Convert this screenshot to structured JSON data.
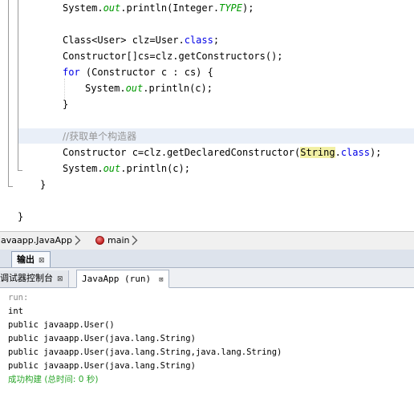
{
  "editor": {
    "line1": {
      "a": "System.",
      "b": "out",
      "c": ".println(Integer.",
      "d": "TYPE",
      "e": ");"
    },
    "line2": {
      "a": "Class<User> clz=User.",
      "b": "class",
      "c": ";"
    },
    "line3": "Constructor[]cs=clz.getConstructors();",
    "line4": {
      "a": "for",
      "b": " (Constructor c : cs) {"
    },
    "line5": {
      "a": "System.",
      "b": "out",
      "c": ".println(c);"
    },
    "line6": "}",
    "comment": "//获取单个构造器",
    "line8": {
      "a": "Constructor c=clz.getDeclaredConstructor(",
      "b": "String",
      "c": ".",
      "d": "class",
      "e": ");"
    },
    "line9": {
      "a": "System.",
      "b": "out",
      "c": ".println(c);"
    },
    "close_method": "}",
    "close_class": "}"
  },
  "breadcrumb": {
    "class_path": "javaapp.JavaApp",
    "method": "main"
  },
  "output_window": {
    "title": "输出",
    "close_glyph": "⊠"
  },
  "output_tabs": {
    "debugger": "调试器控制台",
    "run": "JavaApp (run)",
    "close_glyph": "⊠"
  },
  "console": [
    "run:",
    "int",
    "public javaapp.User()",
    "public javaapp.User(java.lang.String)",
    "public javaapp.User(java.lang.String,java.lang.String)",
    "public javaapp.User(java.lang.String)",
    "成功构建 (总时间: 0 秒)"
  ],
  "colors": {
    "keyword": "#0000e6",
    "static_field": "#009900",
    "comment": "#969696",
    "build_success": "#2aa52a",
    "current_line": "#e9eff8",
    "match_highlight": "#f2f0a4"
  },
  "icons": {
    "breadcrumb_separator": "chevron-right-icon",
    "method": "method-icon",
    "close": "close-icon"
  }
}
